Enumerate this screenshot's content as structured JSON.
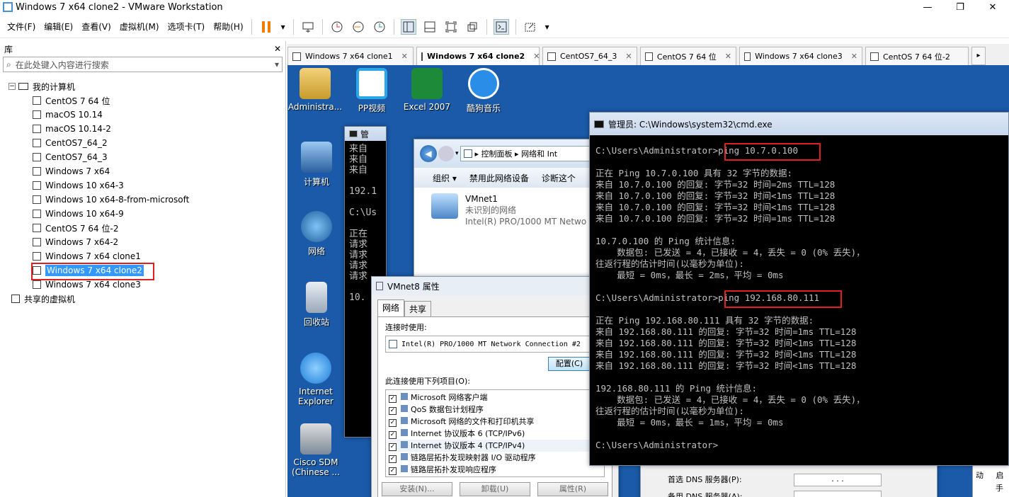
{
  "window": {
    "title": "Windows 7 x64 clone2 - VMware Workstation",
    "minimize": "—",
    "restore": "❐",
    "close": "✕"
  },
  "menu": [
    "文件(F)",
    "编辑(E)",
    "查看(V)",
    "虚拟机(M)",
    "选项卡(T)",
    "帮助(H)"
  ],
  "library": {
    "title": "库",
    "close": "✕",
    "search_placeholder": "在此处键入内容进行搜索",
    "root": "我的计算机",
    "vms": [
      "CentOS 7 64 位",
      "macOS 10.14",
      "macOS 10.14-2",
      "CentOS7_64_2",
      "CentOS7_64_3",
      "Windows 7 x64",
      "Windows 10 x64-3",
      "Windows 10 x64-8-from-microsoft",
      "Windows 10 x64-9",
      "CentOS 7 64 位-2",
      "Windows 7 x64-2",
      "Windows 7 x64 clone1",
      "Windows 7 x64 clone2",
      "Windows 7 x64 clone3"
    ],
    "selected": "Windows 7 x64 clone2",
    "shared": "共享的虚拟机"
  },
  "tabs": [
    {
      "label": "Windows 7 x64 clone1"
    },
    {
      "label": "Windows 7 x64 clone2"
    },
    {
      "label": "CentOS7_64_3"
    },
    {
      "label": "CentOS 7 64 位"
    },
    {
      "label": "Windows 7 x64 clone3"
    },
    {
      "label": "CentOS 7 64 位-2"
    }
  ],
  "desktop": {
    "top_icons": [
      "Administra...",
      "PP视频",
      "Excel 2007",
      "酷狗音乐"
    ],
    "left_icons": [
      "计算机",
      "网络",
      "回收站",
      "Internet Explorer",
      "Cisco SDM (Chinese ..."
    ]
  },
  "cmd_main": {
    "title": "管理员: C:\\Windows\\system32\\cmd.exe",
    "lines": [
      "C:\\Users\\Administrator>ping 10.7.0.100",
      "",
      "正在 Ping 10.7.0.100 具有 32 字节的数据:",
      "来自 10.7.0.100 的回复: 字节=32 时间=2ms TTL=128",
      "来自 10.7.0.100 的回复: 字节=32 时间<1ms TTL=128",
      "来自 10.7.0.100 的回复: 字节=32 时间<1ms TTL=128",
      "来自 10.7.0.100 的回复: 字节=32 时间=1ms TTL=128",
      "",
      "10.7.0.100 的 Ping 统计信息:",
      "    数据包: 已发送 = 4，已接收 = 4，丢失 = 0 (0% 丢失)，",
      "往返行程的估计时间(以毫秒为单位):",
      "    最短 = 0ms，最长 = 2ms，平均 = 0ms",
      "",
      "C:\\Users\\Administrator>ping 192.168.80.111",
      "",
      "正在 Ping 192.168.80.111 具有 32 字节的数据:",
      "来自 192.168.80.111 的回复: 字节=32 时间=1ms TTL=128",
      "来自 192.168.80.111 的回复: 字节=32 时间<1ms TTL=128",
      "来自 192.168.80.111 的回复: 字节=32 时间<1ms TTL=128",
      "来自 192.168.80.111 的回复: 字节=32 时间<1ms TTL=128",
      "",
      "192.168.80.111 的 Ping 统计信息:",
      "    数据包: 已发送 = 4，已接收 = 4，丢失 = 0 (0% 丢失)，",
      "往返行程的估计时间(以毫秒为单位):",
      "    最短 = 0ms，最长 = 1ms，平均 = 0ms",
      "",
      "C:\\Users\\Administrator>"
    ]
  },
  "cmd_back": {
    "title": "管",
    "lines": [
      "来自",
      "来自",
      "来自",
      "",
      "192.1",
      "",
      "C:\\Us",
      "",
      "正在",
      "请求",
      "请求",
      "请求",
      "请求",
      "",
      "10.",
      "",
      "",
      "",
      "",
      "",
      ""
    ]
  },
  "explorer": {
    "breadcrumb": [
      "控制面板",
      "网络和 Int"
    ],
    "commands": [
      "组织 ▾",
      "禁用此网络设备",
      "诊断这个"
    ],
    "adapter_name": "VMnet1",
    "adapter_status": "未识别的网络",
    "adapter_device": "Intel(R) PRO/1000 MT Netwo"
  },
  "props": {
    "title": "VMnet8 属性",
    "tabs": [
      "网络",
      "共享"
    ],
    "connect_using": "连接时使用:",
    "adapter": "Intel(R) PRO/1000 MT Network Connection #2",
    "configure": "配置(C)",
    "items_label": "此连接使用下列项目(O):",
    "items": [
      "Microsoft 网络客户端",
      "QoS 数据包计划程序",
      "Microsoft 网络的文件和打印机共享",
      "Internet 协议版本 6 (TCP/IPv6)",
      "Internet 协议版本 4 (TCP/IPv4)",
      "链路层拓扑发现映射器 I/O 驱动程序",
      "链路层拓扑发现响应程序"
    ],
    "buttons": [
      "安装(N)...",
      "卸载(U)",
      "属性(R)"
    ]
  },
  "ipv4": {
    "dns1": "首选 DNS 服务器(P):",
    "dns2": "备用 DNS 服务器(A):",
    "dots": ".       .       .",
    "right1": "动",
    "right2": "启",
    "right3": "手"
  }
}
